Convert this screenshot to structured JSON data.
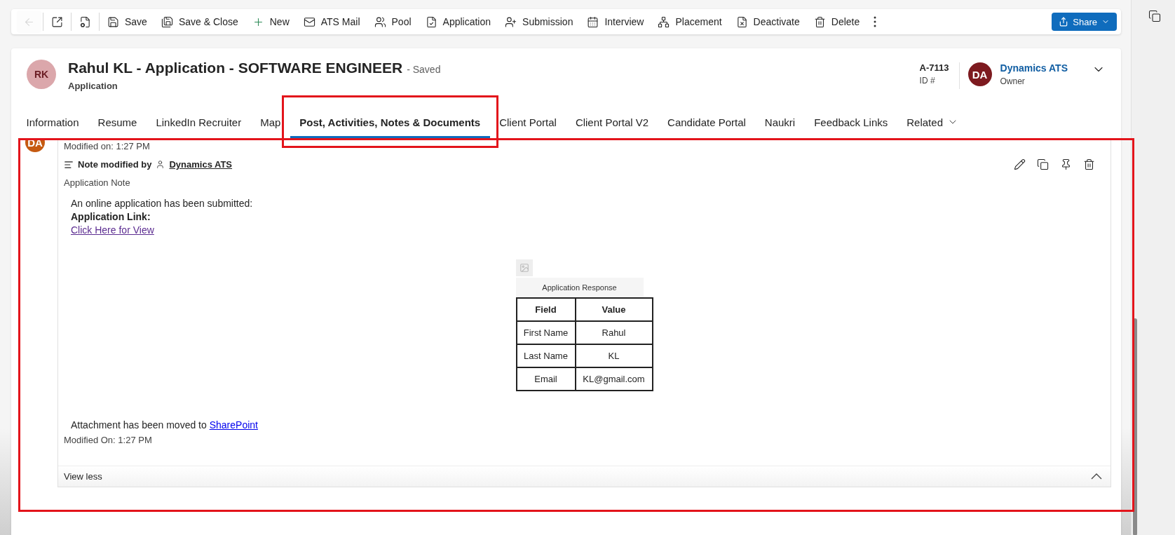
{
  "toolbar": {
    "items": [
      {
        "kind": "icon",
        "disabled": true
      },
      {
        "kind": "icon",
        "disabled": false
      },
      {
        "kind": "icon",
        "disabled": false
      },
      {
        "kind": "labelled",
        "label": "Save",
        "disabled": false
      },
      {
        "kind": "labelled",
        "label": "Save & Close",
        "disabled": false
      },
      {
        "kind": "labelled",
        "label": "New",
        "disabled": false
      },
      {
        "kind": "labelled",
        "label": "ATS Mail",
        "disabled": false
      },
      {
        "kind": "labelled",
        "label": "Pool",
        "disabled": false
      },
      {
        "kind": "labelled",
        "label": "Application",
        "disabled": false
      },
      {
        "kind": "labelled",
        "label": "Submission",
        "disabled": false
      },
      {
        "kind": "labelled",
        "label": "Interview",
        "disabled": false
      },
      {
        "kind": "labelled",
        "label": "Placement",
        "disabled": false
      },
      {
        "kind": "labelled",
        "label": "Deactivate",
        "disabled": false
      },
      {
        "kind": "labelled",
        "label": "Delete",
        "disabled": false
      },
      {
        "kind": "icon",
        "disabled": false
      }
    ],
    "share": {
      "label": "Share"
    }
  },
  "header": {
    "avatar": "RK",
    "title": "Rahul KL - Application - SOFTWARE ENGINEER",
    "status": "- Saved",
    "subtitle": "Application",
    "id_value": "A-7113",
    "id_label": "ID #",
    "owner_avatar": "DA",
    "owner_name": "Dynamics ATS",
    "owner_label": "Owner"
  },
  "tabs": [
    {
      "label": "Information",
      "selected": false,
      "kind": "tab"
    },
    {
      "label": "Resume",
      "selected": false,
      "kind": "tab"
    },
    {
      "label": "LinkedIn Recruiter",
      "selected": false,
      "kind": "tab"
    },
    {
      "label": "Map",
      "selected": false,
      "kind": "tab"
    },
    {
      "label": "Post, Activities, Notes & Documents",
      "selected": true,
      "kind": "tab"
    },
    {
      "label": "Client Portal",
      "selected": false,
      "kind": "tab"
    },
    {
      "label": "Client Portal V2",
      "selected": false,
      "kind": "tab"
    },
    {
      "label": "Candidate Portal",
      "selected": false,
      "kind": "tab"
    },
    {
      "label": "Naukri",
      "selected": false,
      "kind": "tab"
    },
    {
      "label": "Feedback Links",
      "selected": false,
      "kind": "tab"
    },
    {
      "label": "Related",
      "selected": false,
      "kind": "menu"
    }
  ],
  "note": {
    "avatar": "DA",
    "modified_top": "Modified on: 1:27 PM",
    "by_label": "Note modified by",
    "by_name": "Dynamics ATS",
    "title": "Application Note",
    "lines": [
      "An online application has been submitted:",
      "Application Link:"
    ],
    "link": "Click Here for View",
    "table": {
      "caption": "Application Response",
      "columns": [
        "Field",
        "Value"
      ],
      "rows": [
        [
          "First Name",
          "Rahul"
        ],
        [
          "Last Name",
          "KL"
        ],
        [
          "Email",
          "KL@gmail.com"
        ]
      ]
    },
    "attachment_text": "Attachment has been moved to",
    "attachment_link": "SharePoint",
    "modified_bottom": "Modified On: 1:27 PM",
    "toggle": "View less"
  }
}
